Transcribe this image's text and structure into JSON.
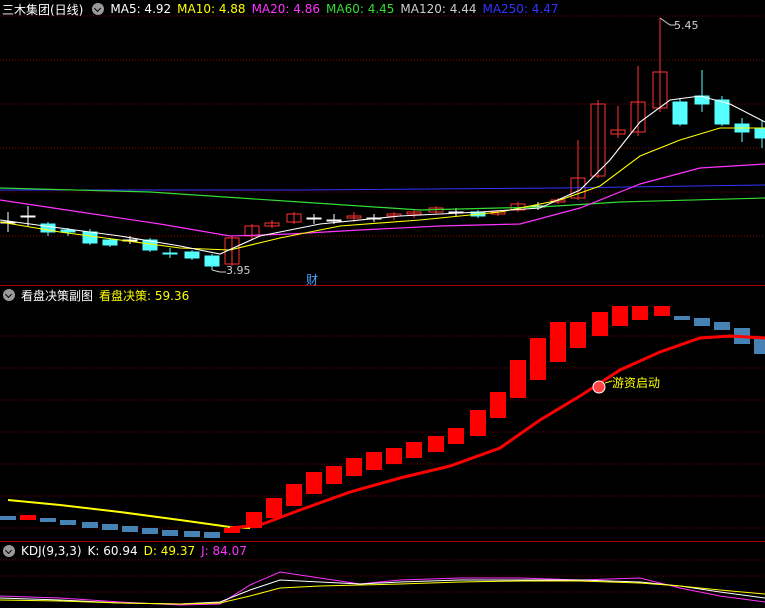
{
  "main_panel": {
    "title": "三木集团(日线)",
    "indicators": [
      {
        "label": "MA5: 4.92",
        "color": "#ffffff"
      },
      {
        "label": "MA10: 4.88",
        "color": "#ffff00"
      },
      {
        "label": "MA20: 4.86",
        "color": "#ff33ff"
      },
      {
        "label": "MA60: 4.45",
        "color": "#33dd33"
      },
      {
        "label": "MA120: 4.44",
        "color": "#cccccc"
      },
      {
        "label": "MA250: 4.47",
        "color": "#3333ff"
      }
    ],
    "high_label": "5.45",
    "low_label": "3.95",
    "finance_marker": "财"
  },
  "sub_panel": {
    "title": "看盘决策副图",
    "indicator": {
      "label": "看盘决策: 59.36",
      "color": "#ffff00"
    },
    "annotation": "游资启动"
  },
  "kdj_panel": {
    "title": "KDJ(9,3,3)",
    "indicators": [
      {
        "label": "K: 60.94",
        "color": "#ffffff"
      },
      {
        "label": "D: 49.37",
        "color": "#ffff00"
      },
      {
        "label": "J: 84.07",
        "color": "#ff33ff"
      }
    ]
  },
  "colors": {
    "up": "#ff3333",
    "down": "#55ffff",
    "grid": "#8b0000",
    "ma5": "#ffffff",
    "ma10": "#ffff00",
    "ma20": "#ff33ff",
    "ma60": "#33dd33",
    "ma250": "#3333ff",
    "decision_up": "#ff0000",
    "decision_down": "#4682b4"
  }
}
